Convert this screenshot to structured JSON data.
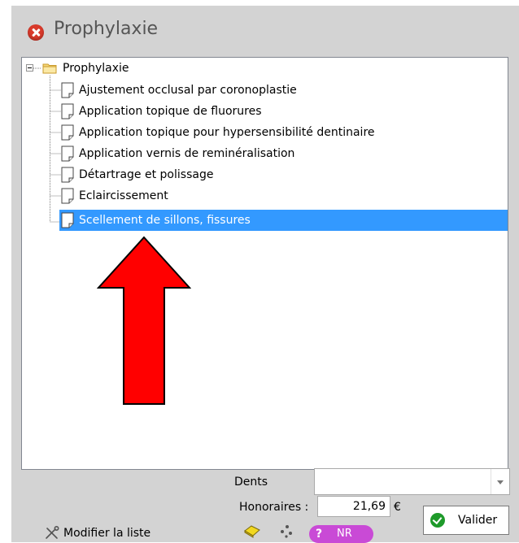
{
  "window": {
    "title": "Prophylaxie"
  },
  "tree": {
    "root_label": "Prophylaxie",
    "items": [
      {
        "label": "Ajustement occlusal par coronoplastie"
      },
      {
        "label": "Application topique de fluorures"
      },
      {
        "label": "Application topique pour hypersensibilité dentinaire"
      },
      {
        "label": "Application vernis de reminéralisation"
      },
      {
        "label": "Détartrage et polissage"
      },
      {
        "label": "Eclaircissement"
      },
      {
        "label": "Scellement de sillons, fissures"
      }
    ],
    "selected_index": 6,
    "selection_color": "#3399ff"
  },
  "annotation": {
    "arrow_color": "#ff0000"
  },
  "form": {
    "dents_label": "Dents",
    "dents_value": "",
    "honoraires_label": "Honoraires :",
    "honoraires_value": "21,69",
    "currency": "€"
  },
  "actions": {
    "valider_label": "Valider",
    "modify_list_label": "Modifier la liste",
    "nr_label": "NR",
    "question_mark": "?"
  },
  "colors": {
    "window_bg": "#d3d3d3",
    "close_red": "#d93a2b",
    "nr_badge": "#c94ad6",
    "check_green": "#1e9a2a"
  },
  "icons": [
    "close-icon",
    "folder-icon",
    "document-icon",
    "check-icon",
    "tools-icon",
    "soap-icon",
    "dots-icon",
    "question-icon",
    "chevron-down-icon"
  ]
}
